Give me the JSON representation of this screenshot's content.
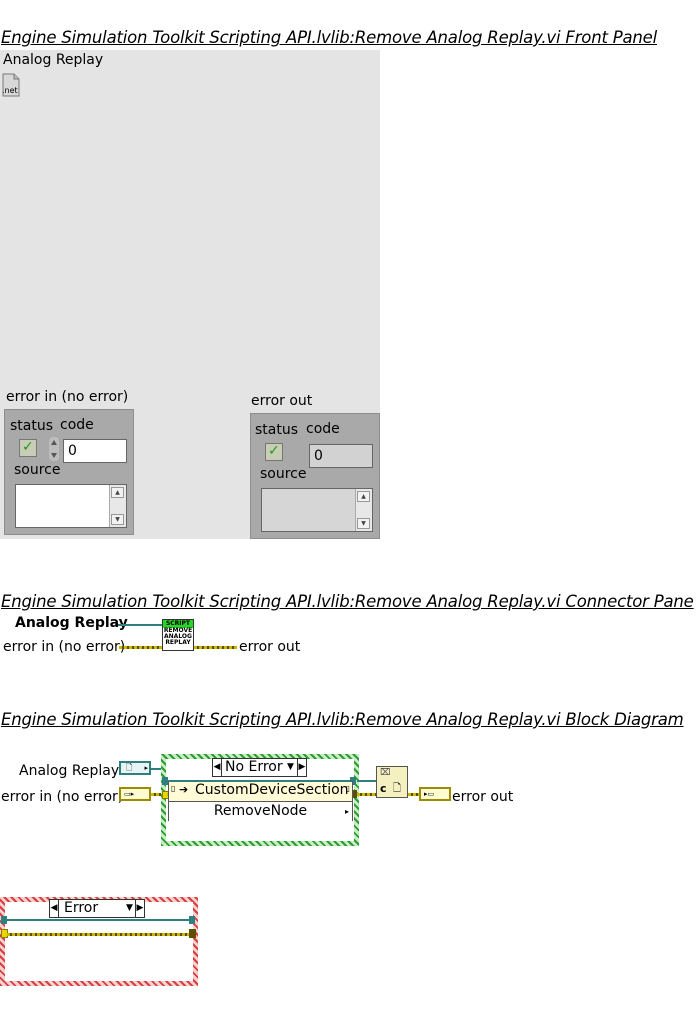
{
  "front_panel": {
    "title": "Engine Simulation Toolkit Scripting API.lvlib:Remove Analog Replay.vi Front Panel",
    "control_label": "Analog Replay",
    "control_icon_text": ".net",
    "error_in": {
      "label": "error in (no error)",
      "status_label": "status",
      "code_label": "code",
      "code_value": "0",
      "source_label": "source",
      "source_value": ""
    },
    "error_out": {
      "label": "error out",
      "status_label": "status",
      "code_label": "code",
      "code_value": "0",
      "source_label": "source",
      "source_value": ""
    }
  },
  "connector_pane": {
    "title": "Engine Simulation Toolkit Scripting API.lvlib:Remove Analog Replay.vi Connector Pane",
    "input_ref_label": "Analog Replay",
    "input_error_label": "error in (no error)",
    "output_error_label": "error out",
    "icon_lines": [
      "SCRIPT",
      "REMOVE",
      "ANALOG",
      "REPLAY"
    ]
  },
  "block_diagram": {
    "title": "Engine Simulation Toolkit Scripting API.lvlib:Remove Analog Replay.vi Block Diagram",
    "ref_label": "Analog Replay",
    "error_in_label": "error in (no error)",
    "error_out_label": "error out",
    "case_no_error": "No Error",
    "invoke_class": "CustomDeviceSection",
    "invoke_method": "RemoveNode",
    "close_ref_text": "c",
    "case_error": "Error",
    "colors": {
      "error_wire": "#ccb400",
      "ref_wire": "#2f7f7f",
      "case_no_error_border": "#2a9d2a",
      "case_error_border": "#d64040"
    }
  }
}
